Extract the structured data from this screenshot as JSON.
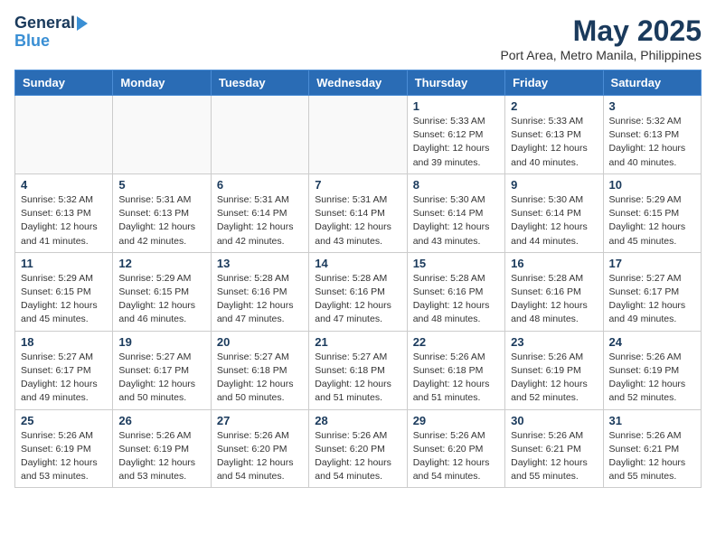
{
  "header": {
    "logo_line1": "General",
    "logo_line2": "Blue",
    "month_year": "May 2025",
    "location": "Port Area, Metro Manila, Philippines"
  },
  "weekdays": [
    "Sunday",
    "Monday",
    "Tuesday",
    "Wednesday",
    "Thursday",
    "Friday",
    "Saturday"
  ],
  "weeks": [
    [
      {
        "day": "",
        "info": ""
      },
      {
        "day": "",
        "info": ""
      },
      {
        "day": "",
        "info": ""
      },
      {
        "day": "",
        "info": ""
      },
      {
        "day": "1",
        "info": "Sunrise: 5:33 AM\nSunset: 6:12 PM\nDaylight: 12 hours\nand 39 minutes."
      },
      {
        "day": "2",
        "info": "Sunrise: 5:33 AM\nSunset: 6:13 PM\nDaylight: 12 hours\nand 40 minutes."
      },
      {
        "day": "3",
        "info": "Sunrise: 5:32 AM\nSunset: 6:13 PM\nDaylight: 12 hours\nand 40 minutes."
      }
    ],
    [
      {
        "day": "4",
        "info": "Sunrise: 5:32 AM\nSunset: 6:13 PM\nDaylight: 12 hours\nand 41 minutes."
      },
      {
        "day": "5",
        "info": "Sunrise: 5:31 AM\nSunset: 6:13 PM\nDaylight: 12 hours\nand 42 minutes."
      },
      {
        "day": "6",
        "info": "Sunrise: 5:31 AM\nSunset: 6:14 PM\nDaylight: 12 hours\nand 42 minutes."
      },
      {
        "day": "7",
        "info": "Sunrise: 5:31 AM\nSunset: 6:14 PM\nDaylight: 12 hours\nand 43 minutes."
      },
      {
        "day": "8",
        "info": "Sunrise: 5:30 AM\nSunset: 6:14 PM\nDaylight: 12 hours\nand 43 minutes."
      },
      {
        "day": "9",
        "info": "Sunrise: 5:30 AM\nSunset: 6:14 PM\nDaylight: 12 hours\nand 44 minutes."
      },
      {
        "day": "10",
        "info": "Sunrise: 5:29 AM\nSunset: 6:15 PM\nDaylight: 12 hours\nand 45 minutes."
      }
    ],
    [
      {
        "day": "11",
        "info": "Sunrise: 5:29 AM\nSunset: 6:15 PM\nDaylight: 12 hours\nand 45 minutes."
      },
      {
        "day": "12",
        "info": "Sunrise: 5:29 AM\nSunset: 6:15 PM\nDaylight: 12 hours\nand 46 minutes."
      },
      {
        "day": "13",
        "info": "Sunrise: 5:28 AM\nSunset: 6:16 PM\nDaylight: 12 hours\nand 47 minutes."
      },
      {
        "day": "14",
        "info": "Sunrise: 5:28 AM\nSunset: 6:16 PM\nDaylight: 12 hours\nand 47 minutes."
      },
      {
        "day": "15",
        "info": "Sunrise: 5:28 AM\nSunset: 6:16 PM\nDaylight: 12 hours\nand 48 minutes."
      },
      {
        "day": "16",
        "info": "Sunrise: 5:28 AM\nSunset: 6:16 PM\nDaylight: 12 hours\nand 48 minutes."
      },
      {
        "day": "17",
        "info": "Sunrise: 5:27 AM\nSunset: 6:17 PM\nDaylight: 12 hours\nand 49 minutes."
      }
    ],
    [
      {
        "day": "18",
        "info": "Sunrise: 5:27 AM\nSunset: 6:17 PM\nDaylight: 12 hours\nand 49 minutes."
      },
      {
        "day": "19",
        "info": "Sunrise: 5:27 AM\nSunset: 6:17 PM\nDaylight: 12 hours\nand 50 minutes."
      },
      {
        "day": "20",
        "info": "Sunrise: 5:27 AM\nSunset: 6:18 PM\nDaylight: 12 hours\nand 50 minutes."
      },
      {
        "day": "21",
        "info": "Sunrise: 5:27 AM\nSunset: 6:18 PM\nDaylight: 12 hours\nand 51 minutes."
      },
      {
        "day": "22",
        "info": "Sunrise: 5:26 AM\nSunset: 6:18 PM\nDaylight: 12 hours\nand 51 minutes."
      },
      {
        "day": "23",
        "info": "Sunrise: 5:26 AM\nSunset: 6:19 PM\nDaylight: 12 hours\nand 52 minutes."
      },
      {
        "day": "24",
        "info": "Sunrise: 5:26 AM\nSunset: 6:19 PM\nDaylight: 12 hours\nand 52 minutes."
      }
    ],
    [
      {
        "day": "25",
        "info": "Sunrise: 5:26 AM\nSunset: 6:19 PM\nDaylight: 12 hours\nand 53 minutes."
      },
      {
        "day": "26",
        "info": "Sunrise: 5:26 AM\nSunset: 6:19 PM\nDaylight: 12 hours\nand 53 minutes."
      },
      {
        "day": "27",
        "info": "Sunrise: 5:26 AM\nSunset: 6:20 PM\nDaylight: 12 hours\nand 54 minutes."
      },
      {
        "day": "28",
        "info": "Sunrise: 5:26 AM\nSunset: 6:20 PM\nDaylight: 12 hours\nand 54 minutes."
      },
      {
        "day": "29",
        "info": "Sunrise: 5:26 AM\nSunset: 6:20 PM\nDaylight: 12 hours\nand 54 minutes."
      },
      {
        "day": "30",
        "info": "Sunrise: 5:26 AM\nSunset: 6:21 PM\nDaylight: 12 hours\nand 55 minutes."
      },
      {
        "day": "31",
        "info": "Sunrise: 5:26 AM\nSunset: 6:21 PM\nDaylight: 12 hours\nand 55 minutes."
      }
    ]
  ]
}
